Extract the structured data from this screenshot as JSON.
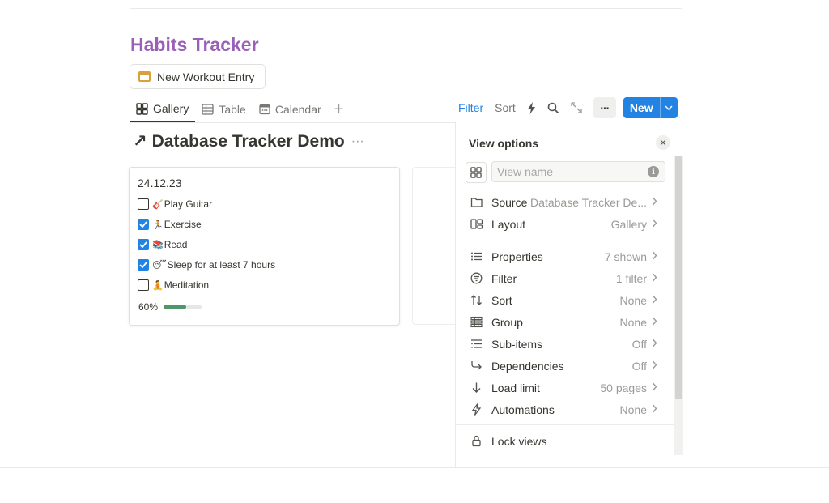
{
  "page": {
    "title": "Habits Tracker",
    "new_entry_button": "New Workout Entry"
  },
  "tabs": [
    {
      "label": "Gallery",
      "active": true
    },
    {
      "label": "Table"
    },
    {
      "label": "Calendar"
    }
  ],
  "toolbar": {
    "filter": "Filter",
    "sort": "Sort",
    "new_label": "New"
  },
  "database": {
    "title": "Database Tracker Demo",
    "link_arrow": "↗",
    "dots": "···"
  },
  "card": {
    "date": "24.12.23",
    "todos": [
      {
        "emoji": "🎸",
        "label": "Play Guitar",
        "checked": false
      },
      {
        "emoji": "🏃",
        "label": "Exercise",
        "checked": true
      },
      {
        "emoji": "📚",
        "label": "Read",
        "checked": true
      },
      {
        "emoji": "😴",
        "label": "Sleep for at least 7 hours",
        "checked": true
      },
      {
        "emoji": "🧘",
        "label": "Meditation",
        "checked": false
      }
    ],
    "progress_label": "60%",
    "progress": 0.6
  },
  "view_options": {
    "title": "View options",
    "view_name_placeholder": "View name",
    "rows": [
      {
        "icon": "folder-icon",
        "label": "Source",
        "value": "Database Tracker De..."
      },
      {
        "icon": "layout-icon",
        "label": "Layout",
        "value": "Gallery"
      },
      {
        "icon": "list-icon",
        "label": "Properties",
        "value": "7 shown"
      },
      {
        "icon": "filter-icon",
        "label": "Filter",
        "value": "1 filter"
      },
      {
        "icon": "sort-icon",
        "label": "Sort",
        "value": "None"
      },
      {
        "icon": "group-icon",
        "label": "Group",
        "value": "None"
      },
      {
        "icon": "subitems-icon",
        "label": "Sub-items",
        "value": "Off"
      },
      {
        "icon": "dependencies-icon",
        "label": "Dependencies",
        "value": "Off"
      },
      {
        "icon": "arrow-down-icon",
        "label": "Load limit",
        "value": "50 pages"
      },
      {
        "icon": "lightning-icon",
        "label": "Automations",
        "value": "None"
      },
      {
        "icon": "lock-icon",
        "label": "Lock views",
        "value": ""
      }
    ]
  },
  "colors": {
    "title": "#9a5fb6",
    "accent": "#2383e2",
    "progress": "#4f9768"
  }
}
